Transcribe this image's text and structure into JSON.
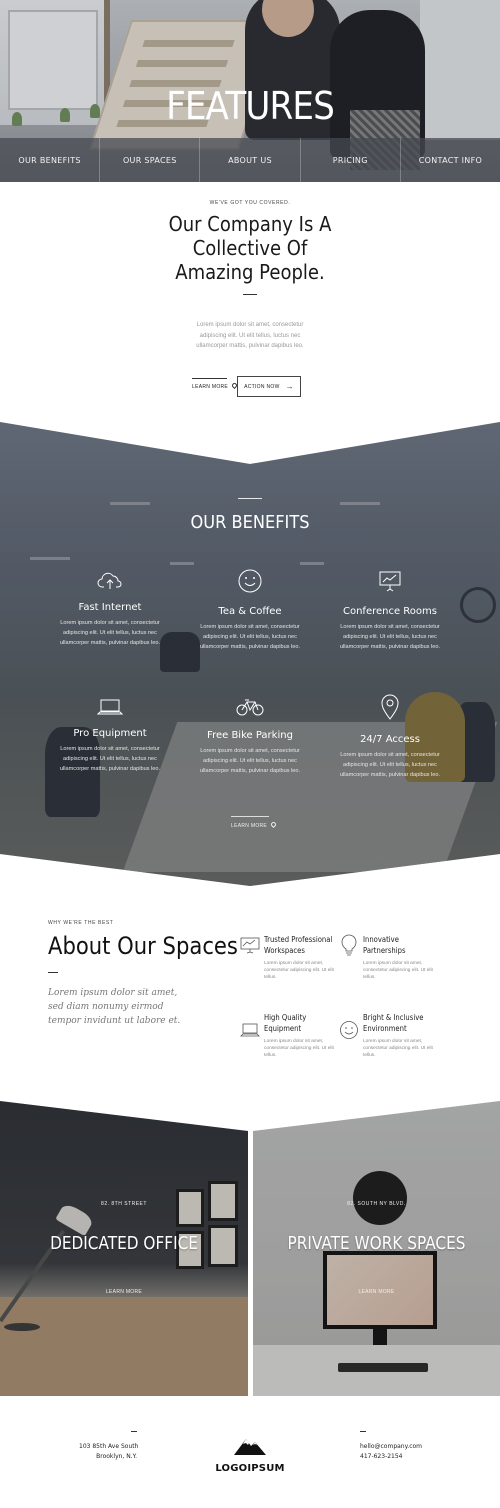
{
  "hero": {
    "title": "FEATURES",
    "nav": [
      "OUR BENEFITS",
      "OUR SPACES",
      "ABOUT US",
      "PRICING",
      "CONTACT INFO"
    ]
  },
  "intro": {
    "eyebrow": "WE'VE GOT YOU COVERED.",
    "heading": "Our Company Is A Collective Of Amazing People.",
    "body": "Lorem ipsum dolor sit amet, consectetur adipiscing elit. Ut elit tellus, luctus nec ullamcorper mattis, pulvinar dapibus leo.",
    "learn_more": "LEARN MORE",
    "action_label": "ACTION NOW"
  },
  "benefits": {
    "title": "OUR BENEFITS",
    "items": [
      {
        "icon": "cloud-upload-icon",
        "title": "Fast Internet",
        "text": "Lorem ipsum dolor sit amet, consectetur adipiscing elit. Ut elit tellus, luctus nec ullamcorper mattis, pulvinar dapibus leo."
      },
      {
        "icon": "smiley-icon",
        "title": "Tea & Coffee",
        "text": "Lorem ipsum dolor sit amet, consectetur adipiscing elit. Ut elit tellus, luctus nec ullamcorper mattis, pulvinar dapibus leo."
      },
      {
        "icon": "presentation-icon",
        "title": "Conference Rooms",
        "text": "Lorem ipsum dolor sit amet, consectetur adipiscing elit. Ut elit tellus, luctus nec ullamcorper mattis, pulvinar dapibus leo."
      },
      {
        "icon": "laptop-icon",
        "title": "Pro Equipment",
        "text": "Lorem ipsum dolor sit amet, consectetur adipiscing elit. Ut elit tellus, luctus nec ullamcorper mattis, pulvinar dapibus leo."
      },
      {
        "icon": "bicycle-icon",
        "title": "Free Bike Parking",
        "text": "Lorem ipsum dolor sit amet, consectetur adipiscing elit. Ut elit tellus, luctus nec ullamcorper mattis, pulvinar dapibus leo."
      },
      {
        "icon": "location-pin-icon",
        "title": "24/7 Access",
        "text": "Lorem ipsum dolor sit amet, consectetur adipiscing elit. Ut elit tellus, luctus nec ullamcorper mattis, pulvinar dapibus leo."
      }
    ],
    "learn_more": "LEARN MORE"
  },
  "about": {
    "eyebrow": "WHY WE'RE THE BEST",
    "title": "About Our Spaces",
    "lead": "Lorem ipsum dolor sit amet, sed diam nonumy eirmod tempor invidunt ut labore et.",
    "features": [
      {
        "icon": "presentation-icon",
        "title": "Trusted Professional Workspaces",
        "text": "Lorem ipsum dolor sit amet, consectetur adipiscing elit. Ut elit tellus."
      },
      {
        "icon": "lightbulb-icon",
        "title": "Innovative Partnerships",
        "text": "Lorem ipsum dolor sit amet, consectetur adipiscing elit. Ut elit tellus."
      },
      {
        "icon": "laptop-icon",
        "title": "High Quality Equipment",
        "text": "Lorem ipsum dolor sit amet, consectetur adipiscing elit. Ut elit tellus."
      },
      {
        "icon": "smiley-icon",
        "title": "Bright & Inclusive Environment",
        "text": "Lorem ipsum dolor sit amet, consectetur adipiscing elit. Ut elit tellus."
      }
    ]
  },
  "spaces": [
    {
      "tag": "82. 8TH STREET",
      "title": "DEDICATED OFFICE",
      "more": "LEARN MORE"
    },
    {
      "tag": "82. SOUTH NY BLVD.",
      "title": "PRIVATE WORK SPACES",
      "more": "LEARN MORE"
    }
  ],
  "footer": {
    "address_line1": "103 85th Ave  South",
    "address_line2": "Brooklyn, N.Y.",
    "logo": "LOGOIPSUM",
    "email": "hello@company.com",
    "phone": "417-623-2154"
  }
}
